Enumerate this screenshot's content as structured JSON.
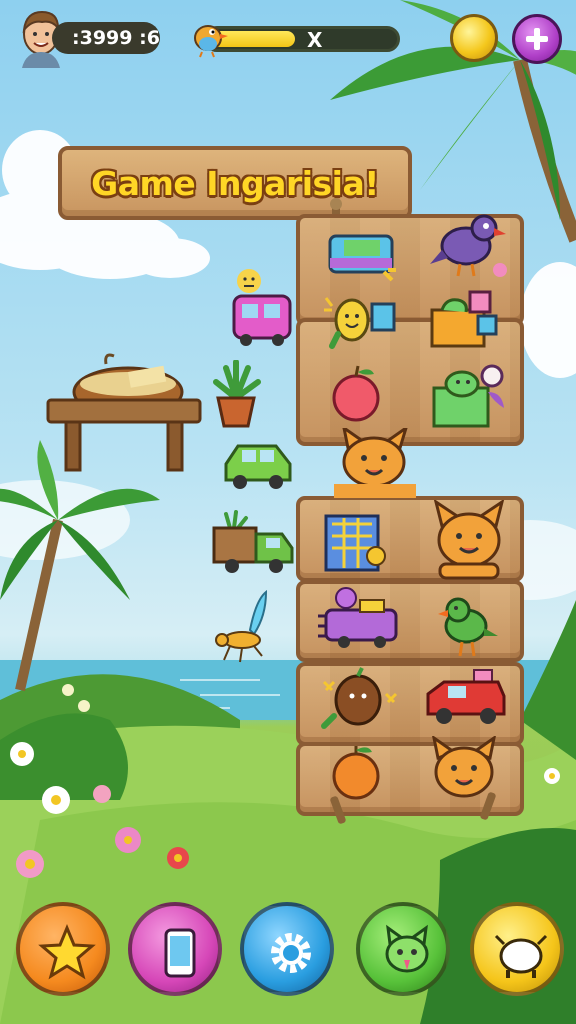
{
  "hud": {
    "score_text": ":3999 :6",
    "progress_fraction": 0.46,
    "progress_label": "X"
  },
  "title": "Game Ingarisia!",
  "shelf_rows": [
    {
      "left": "toy-camper-icon",
      "right": "purple-bird-icon"
    },
    {
      "left": "lemon-creature-icon",
      "right": "toy-blocks-icon"
    },
    {
      "left": "apple-icon",
      "right": "green-block-creature-icon"
    },
    {
      "left": "board-game-box-icon",
      "right": "orange-cat-icon"
    },
    {
      "left": "purple-toy-car-icon",
      "right": "green-bird-icon"
    },
    {
      "left": "coconut-creature-icon",
      "right": "red-toy-truck-icon"
    },
    {
      "left": "orange-fruit-icon",
      "right": "orange-cat-icon"
    }
  ],
  "bottom_buttons": [
    {
      "name": "star-icon",
      "color": "#f58a1f"
    },
    {
      "name": "phone-card-icon",
      "color": "#d647b8"
    },
    {
      "name": "settings-gear-icon",
      "color": "#2a9ee0"
    },
    {
      "name": "cat-face-icon",
      "color": "#58c23a"
    },
    {
      "name": "cow-icon",
      "color": "#f5c51a"
    }
  ],
  "colors": {
    "sky": "#8ed0ef",
    "wood": "#c89560",
    "wood_border": "#8a5b34",
    "title_text": "#ffd626"
  }
}
